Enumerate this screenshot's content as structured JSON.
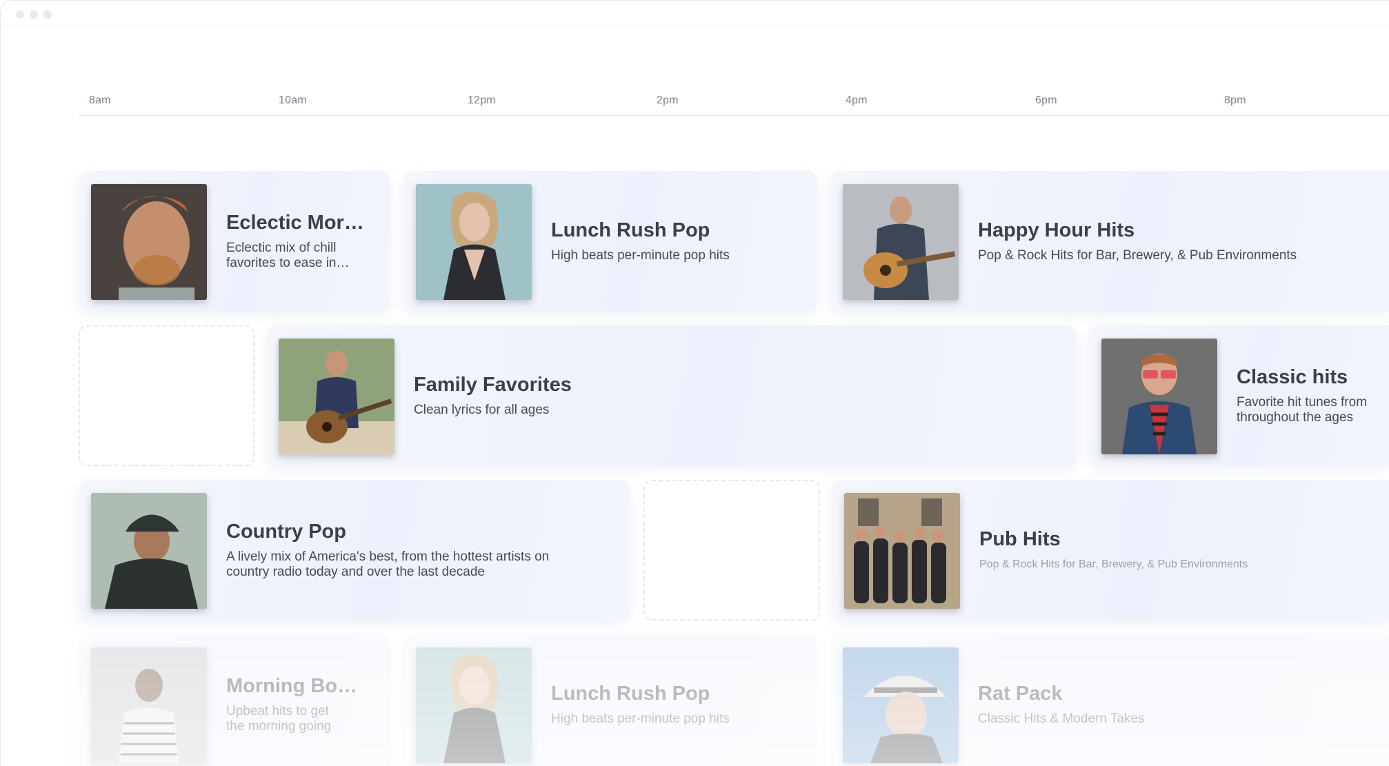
{
  "timeline": {
    "ticks": [
      "8am",
      "10am",
      "12pm",
      "2pm",
      "4pm",
      "6pm",
      "8pm"
    ]
  },
  "rows": [
    [
      {
        "title": "Eclectic Mor…",
        "desc": "Eclectic mix of chill favorites to ease in…",
        "art_icon": "artist-portrait-icon"
      },
      {
        "title": "Lunch Rush Pop",
        "desc": "High beats per-minute pop hits",
        "art_icon": "artist-portrait-icon"
      },
      {
        "title": "Happy Hour Hits",
        "desc": "Pop & Rock Hits for Bar, Brewery, & Pub Environments",
        "art_icon": "guitarist-icon"
      }
    ],
    [
      {
        "title": "Family Favorites",
        "desc": "Clean lyrics for all ages",
        "art_icon": "guitarist-icon"
      },
      {
        "title": "Classic hits",
        "desc": "Favorite hit tunes from throughout the ages",
        "art_icon": "artist-portrait-icon"
      }
    ],
    [
      {
        "title": "Country Pop",
        "desc": "A lively mix of America's best, from the hottest artists on country radio today and over the last decade",
        "art_icon": "artist-portrait-icon"
      },
      {
        "title": "Pub Hits",
        "desc": "Pop & Rock Hits for Bar, Brewery, & Pub Environments",
        "art_icon": "band-photo-icon"
      }
    ],
    [
      {
        "title": "Morning Bo…",
        "desc": "Upbeat hits to get the morning going",
        "art_icon": "artist-portrait-icon"
      },
      {
        "title": "Lunch Rush Pop",
        "desc": "High beats per-minute pop hits",
        "art_icon": "artist-portrait-icon"
      },
      {
        "title": "Rat Pack",
        "desc": "Classic Hits & Modern Takes",
        "art_icon": "artist-portrait-icon"
      }
    ]
  ],
  "colors": {
    "card_bg": "#eef1fb",
    "text": "#3b3f4a",
    "muted": "#7b8090"
  }
}
